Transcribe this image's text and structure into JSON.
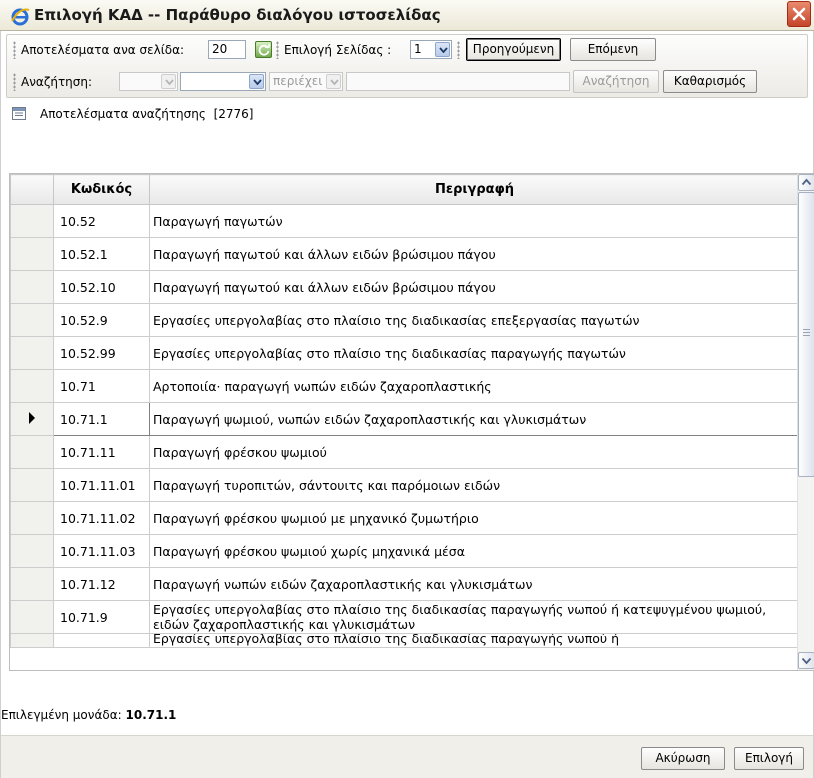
{
  "window": {
    "title": "Επιλογή ΚΑΔ -- Παράθυρο διαλόγου ιστοσελίδας",
    "icon": "ie-icon",
    "close_icon": "close-icon"
  },
  "toolbar": {
    "results_per_page_label": "Αποτελέσματα ανα σελίδα:",
    "results_per_page_value": "20",
    "page_select_label": "Επιλογή Σελίδας :",
    "page_select_value": "1",
    "prev_button": "Προηγούμενη",
    "next_button": "Επόμενη",
    "search_label": "Αναζήτηση:",
    "search_field_value": "",
    "operator_value": "περιέχει",
    "search_text_value": "",
    "search_button": "Αναζήτηση",
    "clear_button": "Καθαρισμός"
  },
  "results": {
    "label": "Αποτελέσματα αναζήτησης",
    "count": "[2776]"
  },
  "table": {
    "columns": [
      "Κωδικός",
      "Περιγραφή"
    ],
    "rows": [
      {
        "code": "10.52",
        "desc": "Παραγωγή παγωτών"
      },
      {
        "code": "10.52.1",
        "desc": "Παραγωγή παγωτού και άλλων ειδών βρώσιμου πάγου"
      },
      {
        "code": "10.52.10",
        "desc": "Παραγωγή παγωτού και άλλων ειδών βρώσιμου πάγου"
      },
      {
        "code": "10.52.9",
        "desc": "Εργασίες υπεργολαβίας στο πλαίσιο της διαδικασίας επεξεργασίας παγωτών"
      },
      {
        "code": "10.52.99",
        "desc": "Εργασίες υπεργολαβίας στο πλαίσιο της διαδικασίας παραγωγής παγωτών"
      },
      {
        "code": "10.71",
        "desc": "Αρτοποιία· παραγωγή νωπών ειδών ζαχαροπλαστικής"
      },
      {
        "code": "10.71.1",
        "desc": "Παραγωγή ψωμιού, νωπών ειδών ζαχαροπλαστικής και γλυκισμάτων"
      },
      {
        "code": "10.71.11",
        "desc": "Παραγωγή φρέσκου ψωμιού"
      },
      {
        "code": "10.71.11.01",
        "desc": "Παραγωγή τυροπιτών, σάντουιτς και παρόμοιων ειδών"
      },
      {
        "code": "10.71.11.02",
        "desc": "Παραγωγή φρέσκου ψωμιού με μηχανικό ζυμωτήριο"
      },
      {
        "code": "10.71.11.03",
        "desc": "Παραγωγή φρέσκου ψωμιού χωρίς μηχανικά μέσα"
      },
      {
        "code": "10.71.12",
        "desc": "Παραγωγή νωπών ειδών ζαχαροπλαστικής και γλυκισμάτων"
      },
      {
        "code": "10.71.9",
        "desc": "Εργασίες υπεργολαβίας στο πλαίσιο της διαδικασίας παραγωγής νωπού ή κατεψυγμένου ψωμιού, ειδών ζαχαροπλαστικής και γλυκισμάτων"
      },
      {
        "code": "",
        "desc": "Εργασίες υπεργολαβίας στο πλαίσιο της διαδικασίας παραγωγής νωπού ή"
      }
    ],
    "selected_row_index": 6
  },
  "footer": {
    "selected_label": "Επιλεγμένη μονάδα:",
    "selected_value": "10.71.1",
    "cancel_button": "Ακύρωση",
    "select_button": "Επιλογή"
  },
  "colors": {
    "title_bar": "#ece9d8",
    "close_button": "#c4452a",
    "go_button": "#6fa94a"
  }
}
